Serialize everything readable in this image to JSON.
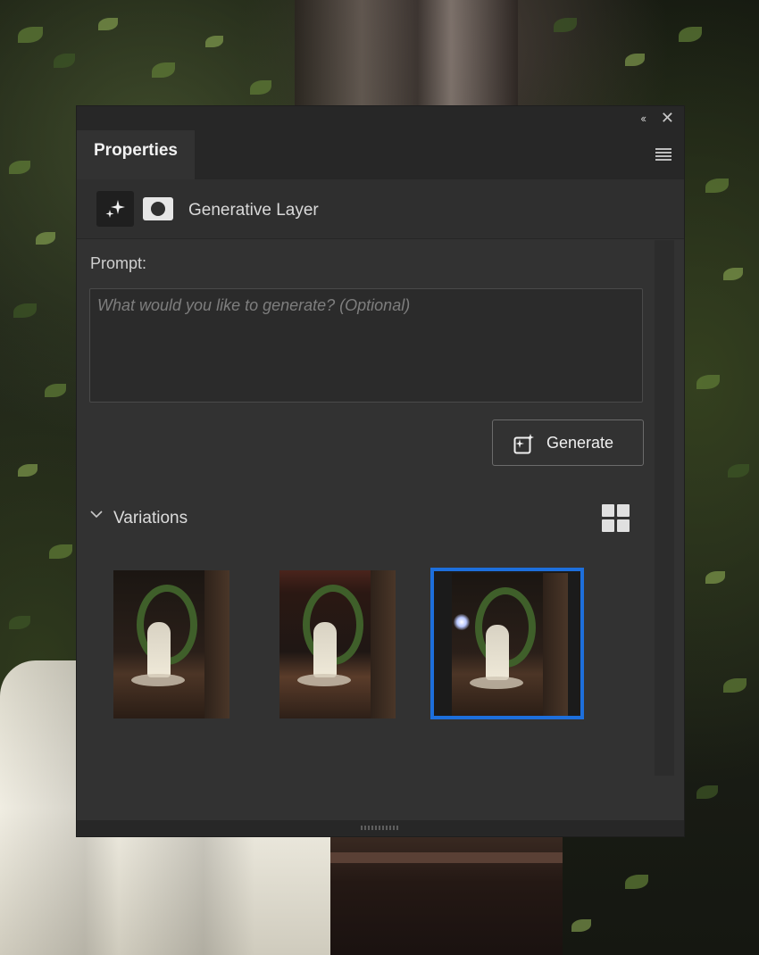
{
  "panel": {
    "tab_label": "Properties",
    "collapse_glyph": "‹‹",
    "close_glyph": "✕",
    "layer_name": "Generative Layer",
    "prompt_label": "Prompt:",
    "prompt_placeholder": "What would you like to generate? (Optional)",
    "prompt_value": "",
    "generate_label": "Generate",
    "variations_label": "Variations",
    "variations": [
      {
        "name": "variation-1",
        "selected": false
      },
      {
        "name": "variation-2",
        "selected": false
      },
      {
        "name": "variation-3",
        "selected": true
      }
    ]
  },
  "icons": {
    "collapse": "double-chevron-left-icon",
    "close": "close-icon",
    "menu": "hamburger-menu-icon",
    "generative": "sparkle-icon",
    "mask": "layer-mask-icon",
    "generate": "generate-sparkle-icon",
    "chevron": "chevron-down-icon",
    "grid": "grid-view-icon"
  },
  "colors": {
    "panel_bg": "#323232",
    "selection_border": "#1d6fdc"
  }
}
